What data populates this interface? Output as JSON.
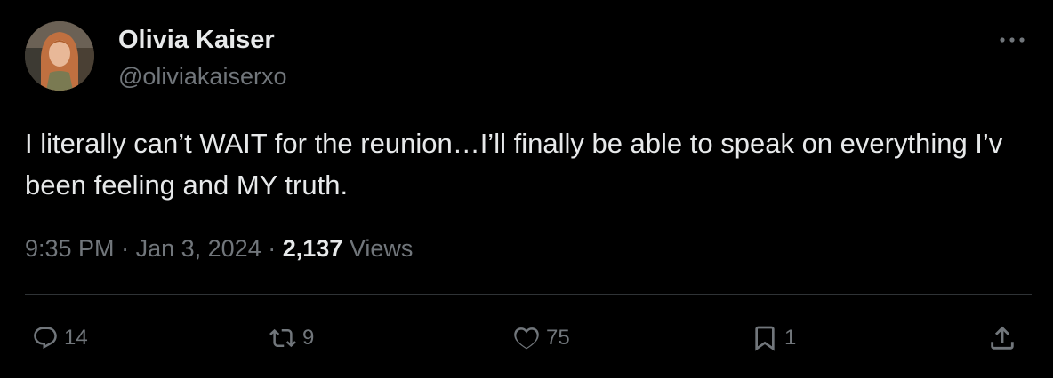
{
  "author": {
    "display_name": "Olivia Kaiser",
    "handle": "@oliviakaiserxo"
  },
  "tweet": {
    "text": "I literally can’t WAIT for the reunion…I’ll finally be able to speak on everything I’v been feeling and MY truth."
  },
  "meta": {
    "time": "9:35 PM",
    "separator": "·",
    "date": "Jan 3, 2024",
    "views_count": "2,137",
    "views_label": "Views"
  },
  "actions": {
    "reply_count": "14",
    "repost_count": "9",
    "like_count": "75",
    "bookmark_count": "1"
  },
  "icons": {
    "more": "more-horizontal-icon",
    "reply": "reply-bubble-icon",
    "repost": "repost-arrows-icon",
    "like": "heart-icon",
    "bookmark": "bookmark-icon",
    "share": "share-upload-icon"
  },
  "colors": {
    "background": "#000000",
    "primary_text": "#e7e9ea",
    "secondary_text": "#71767b",
    "divider": "#2f3336"
  }
}
